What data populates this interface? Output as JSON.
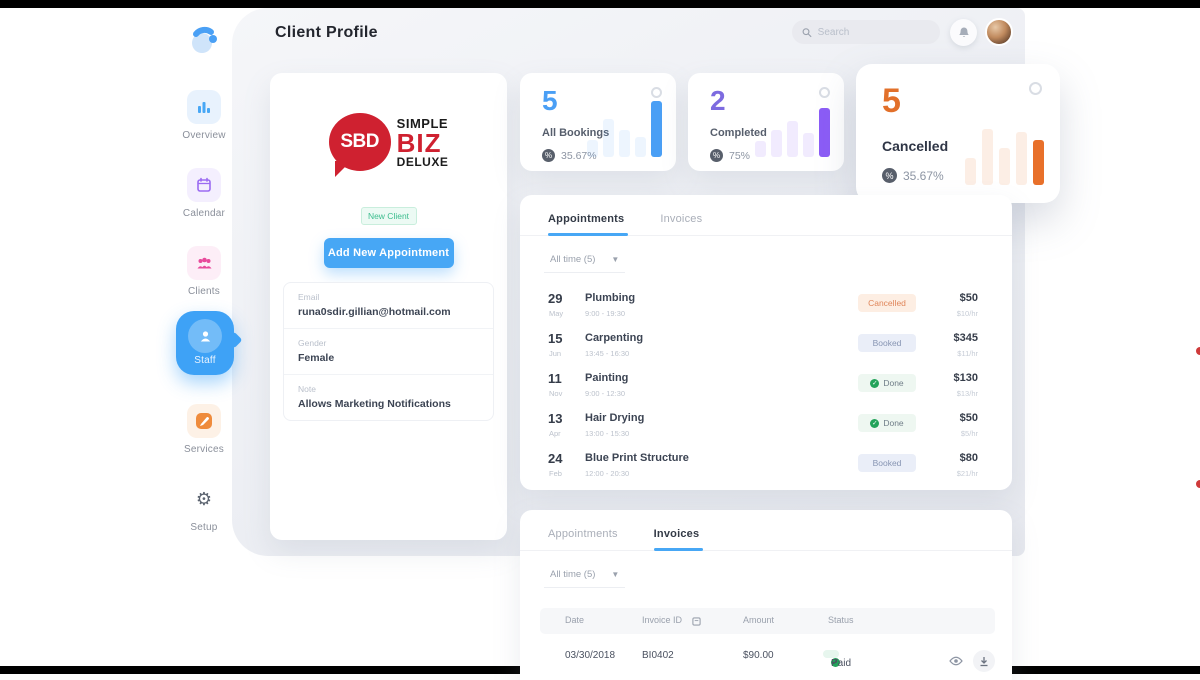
{
  "header": {
    "title": "Client Profile",
    "search_placeholder": "Search"
  },
  "sidebar": {
    "items": [
      {
        "label": "Overview"
      },
      {
        "label": "Calendar"
      },
      {
        "label": "Clients"
      },
      {
        "label": "Staff",
        "active": true
      },
      {
        "label": "Services"
      },
      {
        "label": "Setup"
      }
    ]
  },
  "client_card": {
    "logo": {
      "abbr": "SBD",
      "line1": "SIMPLE",
      "line2": "BIZ",
      "line3": "DELUXE"
    },
    "badge": "New Client",
    "button_label": "Add New Appointment",
    "fields": [
      {
        "label": "Email",
        "value": "runa0sdir.gillian@hotmail.com"
      },
      {
        "label": "Gender",
        "value": "Female"
      },
      {
        "label": "Note",
        "value": "Allows Marketing Notifications"
      }
    ]
  },
  "stats": [
    {
      "value": "5",
      "label": "All Bookings",
      "percent": "35.67%",
      "color": "#4a9ff5",
      "bar_solid": "#4a9ff5",
      "bar_light": "rgba(74,159,245,0.10)",
      "bars": [
        30,
        68,
        48,
        36,
        100
      ]
    },
    {
      "value": "2",
      "label": "Completed",
      "percent": "75%",
      "color": "#7d6be0",
      "bar_solid": "#8b5cf6",
      "bar_light": "rgba(139,92,246,0.12)",
      "bars": [
        28,
        48,
        64,
        42,
        88
      ]
    },
    {
      "value": "5",
      "label": "Cancelled",
      "percent": "35.67%",
      "color": "#e2702a",
      "bar_solid": "#e8702a",
      "bar_light": "rgba(232,112,42,0.12)",
      "bars": [
        38,
        78,
        52,
        74,
        62
      ]
    }
  ],
  "appointments": {
    "tabs": [
      "Appointments",
      "Invoices"
    ],
    "filter": "All time (5)",
    "rows": [
      {
        "day": "29",
        "month": "May",
        "service": "Plumbing",
        "time": "9:00 - 19:30",
        "status": "Cancelled",
        "price": "$50",
        "rate": "$10/hr"
      },
      {
        "day": "15",
        "month": "Jun",
        "service": "Carpenting",
        "time": "13:45 - 16:30",
        "status": "Booked",
        "price": "$345",
        "rate": "$11/hr"
      },
      {
        "day": "11",
        "month": "Nov",
        "service": "Painting",
        "time": "9:00 - 12:30",
        "status": "Done",
        "price": "$130",
        "rate": "$13/hr"
      },
      {
        "day": "13",
        "month": "Apr",
        "service": "Hair Drying",
        "time": "13:00 - 15:30",
        "status": "Done",
        "price": "$50",
        "rate": "$5/hr"
      },
      {
        "day": "24",
        "month": "Feb",
        "service": "Blue Print Structure",
        "time": "12:00 - 20:30",
        "status": "Booked",
        "price": "$80",
        "rate": "$21/hr"
      }
    ]
  },
  "invoices": {
    "tabs": [
      "Appointments",
      "Invoices"
    ],
    "filter": "All time (5)",
    "columns": [
      "Date",
      "Invoice ID",
      "Amount",
      "Status"
    ],
    "rows": [
      {
        "date": "03/30/2018",
        "invoice_id": "BI0402",
        "amount": "$90.00",
        "status": "Paid"
      }
    ]
  }
}
